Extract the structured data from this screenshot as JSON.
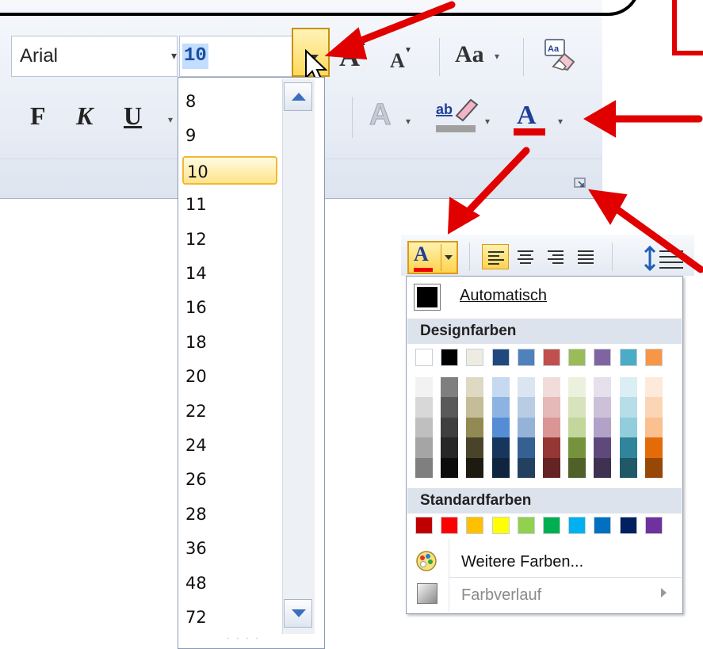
{
  "ribbon": {
    "font_name": "Arial",
    "font_size_value": "10",
    "format_buttons": {
      "bold": "F",
      "italic": "K",
      "underline": "U"
    },
    "grow_font_glyph": "A",
    "shrink_font_glyph": "A",
    "change_case_label": "Aa",
    "text_effect_glyph": "A"
  },
  "font_size_dropdown": {
    "selected": "10",
    "sizes": [
      "8",
      "9",
      "10",
      "11",
      "12",
      "14",
      "16",
      "18",
      "20",
      "22",
      "24",
      "26",
      "28",
      "36",
      "48",
      "72"
    ],
    "grip": "· · · ·"
  },
  "mini_toolbar": {
    "font_color_glyph": "A",
    "align_active": "left"
  },
  "color_dropdown": {
    "automatic_label": "Automatisch",
    "theme_colors_header": "Designfarben",
    "standard_colors_header": "Standardfarben",
    "more_colors_label": "Weitere Farben...",
    "gradient_label": "Farbverlauf",
    "theme_colors": [
      "#ffffff",
      "#000000",
      "#eeece1",
      "#1f497d",
      "#4f81bd",
      "#c0504d",
      "#9bbb59",
      "#8064a2",
      "#4bacc6",
      "#f79646"
    ],
    "theme_shades": [
      [
        "#f2f2f2",
        "#d8d8d8",
        "#bfbfbf",
        "#a5a5a5",
        "#7f7f7f"
      ],
      [
        "#7f7f7f",
        "#595959",
        "#3f3f3f",
        "#262626",
        "#0c0c0c"
      ],
      [
        "#ddd9c3",
        "#c4bd97",
        "#938953",
        "#494429",
        "#1d1b10"
      ],
      [
        "#c6d9f0",
        "#8db3e2",
        "#548dd4",
        "#17365d",
        "#0f243e"
      ],
      [
        "#dbe5f1",
        "#b8cce4",
        "#95b3d7",
        "#366092",
        "#244061"
      ],
      [
        "#f2dcdb",
        "#e5b9b7",
        "#d99694",
        "#953734",
        "#632423"
      ],
      [
        "#ebf1dd",
        "#d7e3bc",
        "#c3d69b",
        "#76923c",
        "#4f6128"
      ],
      [
        "#e5e0ec",
        "#ccc1d9",
        "#b2a2c7",
        "#5f497a",
        "#3f3151"
      ],
      [
        "#dbeef3",
        "#b7dde8",
        "#92cddc",
        "#31859b",
        "#205867"
      ],
      [
        "#fdeada",
        "#fbd5b5",
        "#fac08f",
        "#e36c09",
        "#974806"
      ]
    ],
    "standard_colors": [
      "#c00000",
      "#ff0000",
      "#ffc000",
      "#ffff00",
      "#92d050",
      "#00b050",
      "#00b0f0",
      "#0070c0",
      "#002060",
      "#7030a0"
    ]
  },
  "annotation_color": "#e00000"
}
